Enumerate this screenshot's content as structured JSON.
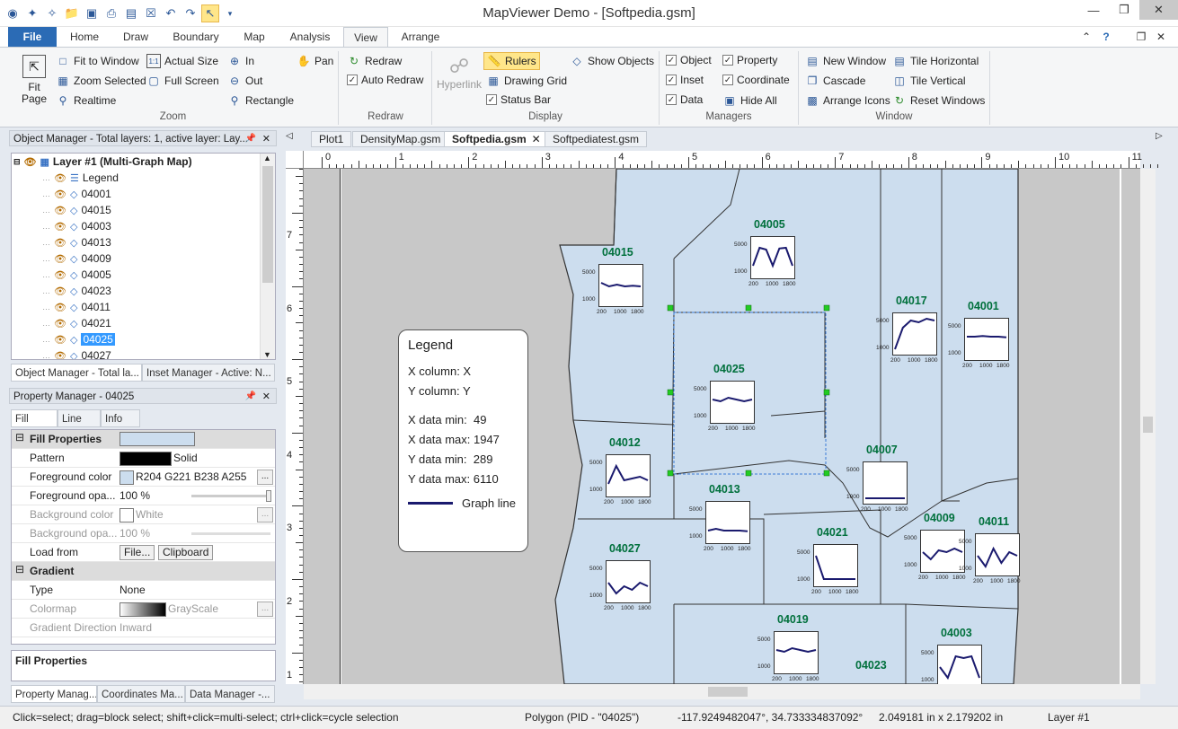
{
  "window": {
    "title": "MapViewer Demo - [Softpedia.gsm]",
    "minimize": "—",
    "restore": "❐",
    "close": "✕"
  },
  "ribbon_tabs": [
    "File",
    "Home",
    "Draw",
    "Boundary",
    "Map",
    "Analysis",
    "View",
    "Arrange"
  ],
  "active_tab": "View",
  "ribbon_right_icons": [
    "⌃",
    "?",
    "❐",
    "✕"
  ],
  "zoom": {
    "fit_page": "Fit\nPage",
    "fit_window": "Fit to Window",
    "actual_size": "Actual Size",
    "pan": "Pan",
    "zoom_selected": "Zoom Selected",
    "full_screen": "Full Screen",
    "out": "Out",
    "realtime": "Realtime",
    "in": "In",
    "rectangle": "Rectangle",
    "label": "Zoom"
  },
  "redraw": {
    "redraw": "Redraw",
    "auto_redraw": "Auto Redraw",
    "label": "Redraw"
  },
  "display": {
    "hyperlink": "Hyperlink",
    "rulers": "Rulers",
    "drawing_grid": "Drawing Grid",
    "status_bar": "Status Bar",
    "show_objects": "Show Objects",
    "label": "Display"
  },
  "managers": {
    "object": "Object",
    "property": "Property",
    "inset": "Inset",
    "coordinate": "Coordinate",
    "data": "Data",
    "hide_all": "Hide All",
    "label": "Managers"
  },
  "window_group": {
    "new_window": "New Window",
    "tile_horizontal": "Tile Horizontal",
    "cascade": "Cascade",
    "tile_vertical": "Tile Vertical",
    "arrange_icons": "Arrange Icons",
    "reset_windows": "Reset Windows",
    "label": "Window"
  },
  "object_manager": {
    "header": "Object Manager - Total layers: 1, active layer: Lay...",
    "layer": "Layer #1 (Multi-Graph Map)",
    "items": [
      "Legend",
      "04001",
      "04015",
      "04003",
      "04013",
      "04009",
      "04005",
      "04023",
      "04011",
      "04021",
      "04025",
      "04027"
    ],
    "selected": "04025"
  },
  "left_tabs_top": [
    "Object Manager - Total la...",
    "Inset Manager - Active: N..."
  ],
  "property_manager": {
    "header": "Property Manager - 04025",
    "tabs": [
      "Fill",
      "Line",
      "Info"
    ],
    "rows": [
      {
        "k": "Fill Properties",
        "v": "",
        "cat": true
      },
      {
        "k": "Pattern",
        "v": "Solid"
      },
      {
        "k": "Foreground color",
        "v": "R204 G221 B238 A255"
      },
      {
        "k": "Foreground opa...",
        "v": "100 %"
      },
      {
        "k": "Background color",
        "v": "White"
      },
      {
        "k": "Background opa...",
        "v": "100 %"
      },
      {
        "k": "Load from",
        "v": "File...",
        "v2": "Clipboard"
      },
      {
        "k": "Gradient",
        "v": "",
        "cat": true
      },
      {
        "k": "Type",
        "v": "None"
      },
      {
        "k": "Colormap",
        "v": "GrayScale"
      },
      {
        "k": "Gradient Direction",
        "v": "Inward"
      }
    ],
    "description": "Fill Properties"
  },
  "left_tabs_bottom": [
    "Property Manag...",
    "Coordinates Ma...",
    "Data Manager -..."
  ],
  "doc_tabs": [
    "Plot1",
    "DensityMap.gsm",
    "Softpedia.gsm",
    "Softpediatest.gsm"
  ],
  "active_doc": "Softpedia.gsm",
  "ruler_h": [
    "0",
    "1",
    "2",
    "3",
    "4",
    "5",
    "6",
    "7",
    "8",
    "9",
    "10",
    "11"
  ],
  "ruler_v": [
    "7",
    "6",
    "5",
    "4",
    "3",
    "2",
    "1"
  ],
  "legend": {
    "title": "Legend",
    "lines": [
      "X column: X",
      "Y column: Y",
      "X data min:  49",
      "X data max: 1947",
      "Y data min:  289",
      "Y data max: 6110"
    ],
    "graph_line": "Graph line"
  },
  "counties": [
    {
      "id": "04015"
    },
    {
      "id": "04005"
    },
    {
      "id": "04017"
    },
    {
      "id": "04001"
    },
    {
      "id": "04025"
    },
    {
      "id": "04012"
    },
    {
      "id": "04007"
    },
    {
      "id": "04013"
    },
    {
      "id": "04009"
    },
    {
      "id": "04011"
    },
    {
      "id": "04027"
    },
    {
      "id": "04021"
    },
    {
      "id": "04019"
    },
    {
      "id": "04003"
    },
    {
      "id": "04023"
    }
  ],
  "graph_axis": {
    "y_top": "5000",
    "y_bottom": "1000",
    "x": [
      "200",
      "1000",
      "1800"
    ]
  },
  "status": {
    "hint": "Click=select; drag=block select; shift+click=multi-select; ctrl+click=cycle selection",
    "object": "Polygon (PID - \"04025\")",
    "coords": "-117.9249482047°, 34.733334837092°",
    "size": "2.049181 in x 2.179202 in",
    "layer": "Layer #1"
  },
  "colors": {
    "accent": "#2b6bb5",
    "county_fill": "#ccddee",
    "label": "#00703c",
    "line": "#1a1a6e"
  }
}
